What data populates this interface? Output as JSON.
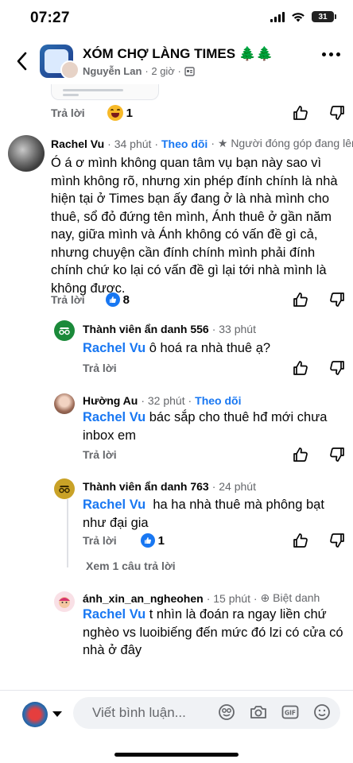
{
  "status": {
    "time": "07:27",
    "battery": "31"
  },
  "header": {
    "title": "XÓM CHỢ LÀNG TIMES 🌲🌲",
    "author": "Nguyễn Lan",
    "time": "· 2 giờ ·"
  },
  "prev_comment": {
    "reply": "Trả lời",
    "reaction_count": "1"
  },
  "comments": [
    {
      "name": "Rachel Vu",
      "meta": "· 34 phút ·",
      "follow": "Theo dõi",
      "badge": "· ★ Người đóng góp đang lên",
      "body": "Ó á ơ mình không quan tâm vụ bạn này sao vì mình không rõ, nhưng xin phép đính chính là nhà hiện tại ở Times bạn ấy đang ở là nhà mình cho thuê, sổ đỏ đứng tên mình, Ánh thuê ở gần năm nay, giữa mình và Ánh không có vấn đề gì cả, nhưng chuyện cần đính chính mình phải đính chính chứ ko lại có vấn đề gì lại tới nhà mình là không được.",
      "reply": "Trả lời",
      "reaction_count": "8"
    },
    {
      "name": "Thành viên ẩn danh 556",
      "meta": "· 33 phút",
      "mention": "Rachel Vu",
      "body": " ô hoá ra nhà thuê ạ?",
      "reply": "Trả lời"
    },
    {
      "name": "Hường Au",
      "meta": "· 32 phút ·",
      "follow": "Theo dõi",
      "mention": "Rachel Vu",
      "body": " bác sắp cho thuê hđ mới chưa inbox em",
      "reply": "Trả lời"
    },
    {
      "name": "Thành viên ẩn danh 763",
      "meta": "· 24 phút",
      "mention": "Rachel Vu",
      "body": "  ha ha nhà thuê mà phông bạt như đại gia",
      "reply": "Trả lời",
      "reaction_count": "1",
      "see_more": "Xem 1 câu trả lời"
    },
    {
      "name": "ánh_xin_an_ngheohen",
      "meta": "· 15 phút ·",
      "badge": "⊕ Biệt danh",
      "mention": "Rachel Vu",
      "body": " t nhìn là đoán ra ngay liền chứ nghèo vs luoibiếng đến mức đó lzi có cửa có nhà ở đây"
    }
  ],
  "composer": {
    "placeholder": "Viết bình luận..."
  },
  "colors": {
    "accent": "#1877f2",
    "secondary_text": "#65676b",
    "anon_556": "#1b8a3a",
    "anon_763": "#c9a227"
  }
}
